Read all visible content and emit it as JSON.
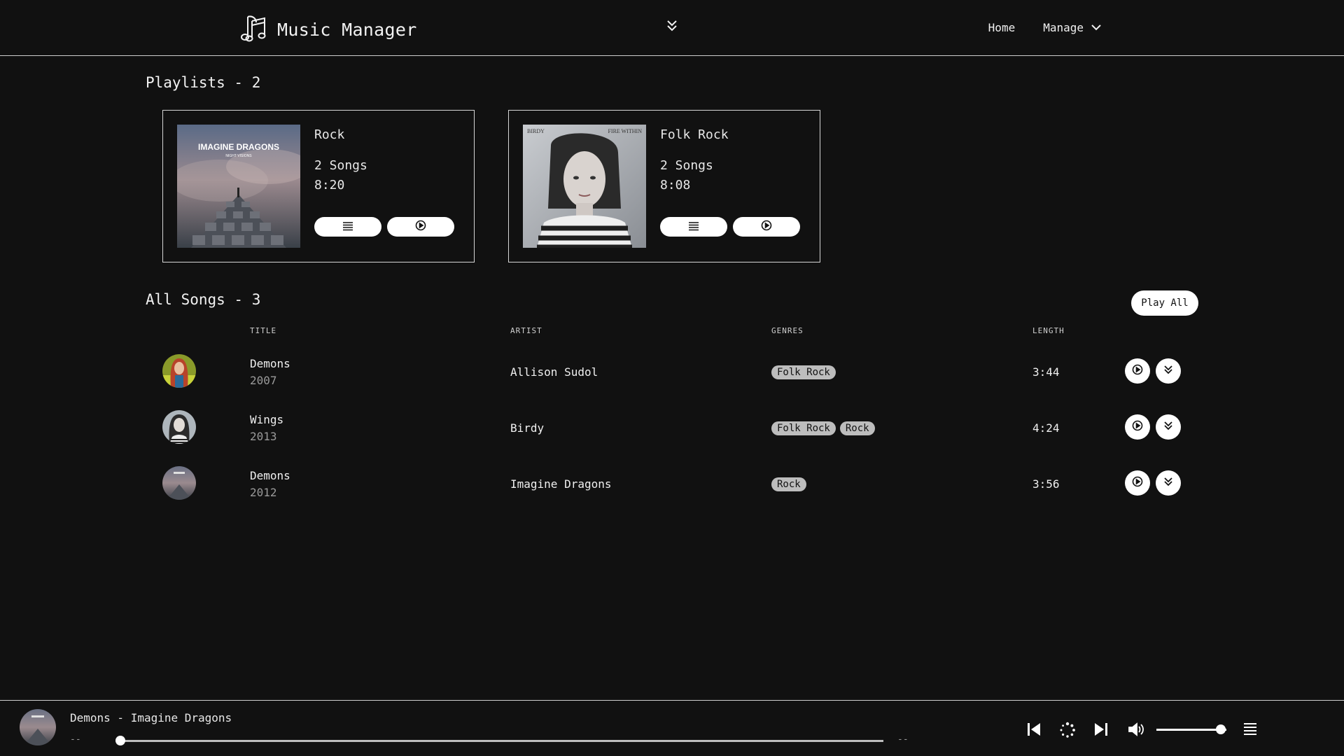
{
  "header": {
    "app_title": "Music Manager",
    "nav": {
      "home": "Home",
      "manage": "Manage"
    }
  },
  "playlists": {
    "heading": "Playlists - 2",
    "items": [
      {
        "name": "Rock",
        "songs": "2 Songs",
        "length": "8:20",
        "cover_text": "IMAGINE DRAGONS",
        "cover_subtext": "NIGHT VISIONS"
      },
      {
        "name": "Folk Rock",
        "songs": "2 Songs",
        "length": "8:08",
        "cover_text_left": "BIRDY",
        "cover_text_right": "FIRE WITHIN"
      }
    ]
  },
  "songs": {
    "heading": "All Songs - 3",
    "play_all": "Play All",
    "columns": {
      "title": "TITLE",
      "artist": "ARTIST",
      "genres": "GENRES",
      "length": "LENGTH"
    },
    "rows": [
      {
        "title": "Demons",
        "year": "2007",
        "artist": "Allison Sudol",
        "genres": [
          "Folk Rock"
        ],
        "length": "3:44"
      },
      {
        "title": "Wings",
        "year": "2013",
        "artist": "Birdy",
        "genres": [
          "Folk Rock",
          "Rock"
        ],
        "length": "4:24"
      },
      {
        "title": "Demons",
        "year": "2012",
        "artist": "Imagine Dragons",
        "genres": [
          "Rock"
        ],
        "length": "3:56"
      }
    ]
  },
  "player": {
    "now_playing": "Demons - Imagine Dragons",
    "time_elapsed": "--",
    "time_total": "--",
    "progress": 0,
    "volume": 0.92
  },
  "colors": {
    "background": "#111111",
    "text": "#e8e8e8",
    "chip": "#bdbdbd",
    "button": "#ffffff"
  },
  "icons": {
    "brand": "music-notes-icon",
    "center": "double-chevron-down-icon",
    "manage": "chevron-down-icon",
    "list": "list-icon",
    "play": "play-circle-icon",
    "queue": "double-chevron-down-icon",
    "prev": "skip-back-icon",
    "loading": "loading-spinner-icon",
    "next": "skip-forward-icon",
    "volume": "volume-icon",
    "queue_list": "list-icon"
  }
}
